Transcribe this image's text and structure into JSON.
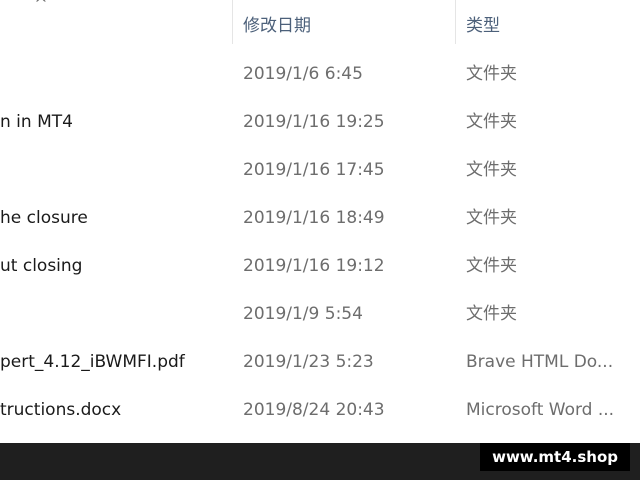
{
  "header": {
    "sort_caret": "^",
    "columns": {
      "date_modified": "修改日期",
      "type": "类型"
    }
  },
  "rows": [
    {
      "name": "",
      "date": "2019/1/6 6:45",
      "type": "文件夹"
    },
    {
      "name": "n in MT4",
      "date": "2019/1/16 19:25",
      "type": "文件夹"
    },
    {
      "name": "",
      "date": "2019/1/16 17:45",
      "type": "文件夹"
    },
    {
      "name": "he closure",
      "date": "2019/1/16 18:49",
      "type": "文件夹"
    },
    {
      "name": "ut closing",
      "date": "2019/1/16 19:12",
      "type": "文件夹"
    },
    {
      "name": "",
      "date": "2019/1/9 5:54",
      "type": "文件夹"
    },
    {
      "name": "pert_4.12_iBWMFI.pdf",
      "date": "2019/1/23 5:23",
      "type": "Brave HTML Do..."
    },
    {
      "name": "tructions.docx",
      "date": "2019/8/24 20:43",
      "type": "Microsoft Word ..."
    }
  ],
  "watermark": "www.mt4.shop"
}
